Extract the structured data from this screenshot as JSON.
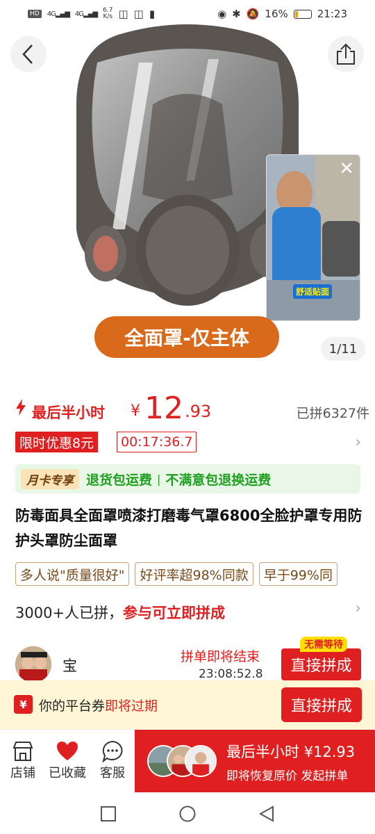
{
  "status": {
    "time": "21:23",
    "battery_pct": "16%",
    "speed_value": "6.7",
    "speed_unit": "K/s",
    "hd": "HD",
    "net1": "4G",
    "net2": "4G"
  },
  "gallery": {
    "option_label": "全面罩-仅主体",
    "pager": "1/11",
    "video_caption": "舒适贴面"
  },
  "price": {
    "flash_label": "最后半小时",
    "currency": "¥",
    "integer": "12",
    "decimal": ".93",
    "sold": "已拼6327件"
  },
  "promo": {
    "tag": "限时优惠8元",
    "countdown": "00:17:36.7"
  },
  "membership": {
    "badge": "月卡专享",
    "benefit1": "退货包运费",
    "separator": "|",
    "benefit2": "不满意包退换运费"
  },
  "product": {
    "title": "防毒面具全面罩喷漆打磨毒气罩6800全脸护罩专用防护头罩防尘面罩"
  },
  "review_tags": [
    "多人说\"质量很好\"",
    "好评率超98%同款",
    "早于99%同"
  ],
  "group": {
    "count_text": "3000+人已拼，",
    "join_text": "参与可立即拼成"
  },
  "joiner": {
    "name": "宝",
    "ending_label": "拼单即将结束",
    "ending_time": "23:08:52.8",
    "join_button": "直接拼成",
    "no_wait_badge": "无需等待"
  },
  "coupon": {
    "icon_glyph": "¥",
    "text_prefix": "你的平台券",
    "text_highlight": "即将过期",
    "button": "直接拼成"
  },
  "bottom_bar": {
    "store": "店铺",
    "favorite": "已收藏",
    "service": "客服",
    "buy_main": "最后半小时 ¥12.93",
    "buy_sub": "即将恢复原价 发起拼单"
  },
  "colors": {
    "accent_red": "#e02020",
    "option_orange": "#d9691b",
    "member_green": "#20a020"
  }
}
